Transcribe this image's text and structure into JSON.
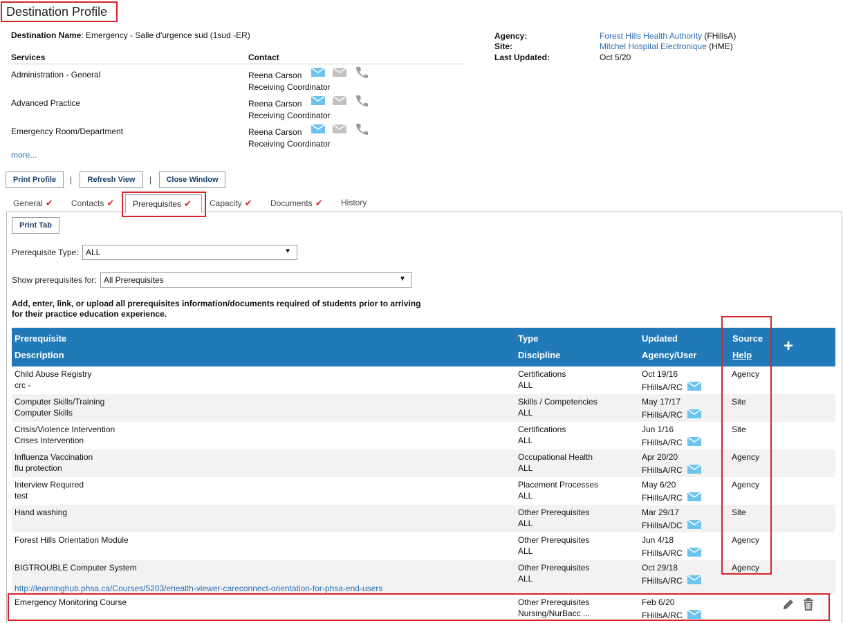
{
  "page_title": "Destination Profile",
  "destination": {
    "label": "Destination Name",
    "value": "Emergency - Salle d'urgence sud (1sud -ER)"
  },
  "services": {
    "header_services": "Services",
    "header_contact": "Contact",
    "items": [
      {
        "name": "Administration - General",
        "contact": "Reena Carson",
        "role": "Receiving Coordinator"
      },
      {
        "name": "Advanced Practice",
        "contact": "Reena Carson",
        "role": "Receiving Coordinator"
      },
      {
        "name": "Emergency Room/Department",
        "contact": "Reena Carson",
        "role": "Receiving Coordinator"
      }
    ],
    "more_link": "more..."
  },
  "meta": {
    "agency_label": "Agency",
    "agency_link": "Forest Hills Health Authority",
    "agency_abbr": "(FHillsA)",
    "site_label": "Site",
    "site_link": "Mitchel Hospital Electronique",
    "site_abbr": "(HME)",
    "updated_label": "Last Updated",
    "updated_value": "Oct 5/20"
  },
  "toolbar": {
    "print_profile": "Print Profile",
    "refresh_view": "Refresh View",
    "close_window": "Close Window",
    "separator": "|"
  },
  "tabs": [
    {
      "label": "General",
      "checked": true
    },
    {
      "label": "Contacts",
      "checked": true
    },
    {
      "label": "Prerequisites",
      "checked": true,
      "active": true
    },
    {
      "label": "Capacity",
      "checked": true
    },
    {
      "label": "Documents",
      "checked": true
    },
    {
      "label": "History",
      "checked": false
    }
  ],
  "check_glyph": "✔",
  "print_tab": "Print Tab",
  "filters": {
    "type_label": "Prerequisite Type:",
    "type_value": "ALL",
    "show_label": "Show prerequisites for:",
    "show_value": "All Prerequisites"
  },
  "notice": "Add, enter, link, or upload all prerequisites information/documents required of students prior to arriving for their practice education experience.",
  "table": {
    "headers": {
      "prerequisite": "Prerequisite",
      "description": "Description",
      "type": "Type",
      "discipline": "Discipline",
      "updated": "Updated",
      "agency_user": "Agency/User",
      "source": "Source",
      "help": "Help",
      "add": "+"
    },
    "rows": [
      {
        "prerequisite": "Child Abuse Registry",
        "description": "crc -",
        "type": "Certifications",
        "discipline": "ALL",
        "updated": "Oct 19/16",
        "user": "FHillsA/RC",
        "source": "Agency"
      },
      {
        "prerequisite": "Computer Skills/Training",
        "description": "Computer Skills",
        "type": "Skills / Competencies",
        "discipline": "ALL",
        "updated": "May 17/17",
        "user": "FHillsA/RC",
        "source": "Site"
      },
      {
        "prerequisite": "Crisis/Violence Intervention",
        "description": "Crises Intervention",
        "type": "Certifications",
        "discipline": "ALL",
        "updated": "Jun 1/16",
        "user": "FHillsA/RC",
        "source": "Site"
      },
      {
        "prerequisite": "Influenza Vaccination",
        "description": "flu protection",
        "type": "Occupational Health",
        "discipline": "ALL",
        "updated": "Apr 20/20",
        "user": "FHillsA/RC",
        "source": "Agency"
      },
      {
        "prerequisite": "Interview Required",
        "description": "test",
        "type": "Placement Processes",
        "discipline": "ALL",
        "updated": "May 6/20",
        "user": "FHillsA/RC",
        "source": "Agency"
      },
      {
        "prerequisite": "Hand washing",
        "description": "",
        "type": "Other Prerequisites",
        "discipline": "ALL",
        "updated": "Mar 29/17",
        "user": "FHillsA/DC",
        "source": "Site"
      },
      {
        "prerequisite": "Forest Hills Orientation Module",
        "description": "",
        "type": "Other Prerequisites",
        "discipline": "ALL",
        "updated": "Jun 4/18",
        "user": "FHillsA/RC",
        "source": "Agency"
      },
      {
        "prerequisite": "BIGTROUBLE Computer System",
        "description": "",
        "type": "Other Prerequisites",
        "discipline": "ALL",
        "updated": "Oct 29/18",
        "user": "FHillsA/RC",
        "source": "Agency",
        "url": "http://learninghub.phsa.ca/Courses/5203/ehealth-viewer-careconnect-orientation-for-phsa-end-users"
      },
      {
        "prerequisite": "Emergency Monitoring Course",
        "description": "",
        "type": "Other Prerequisites",
        "discipline": "Nursing/NurBacc ...",
        "updated": "Feb 6/20",
        "user": "FHillsA/RC",
        "source": "",
        "editable": true
      }
    ]
  },
  "colors": {
    "header_blue": "#2179b8",
    "highlight_red": "#d8232a",
    "mail_blue": "#6ec3ee",
    "icon_grey": "#b5b5b5",
    "link_blue": "#2a6eb0"
  },
  "icons": {
    "mail": "mail-icon",
    "mail_grey": "mail-disabled-icon",
    "phone": "phone-icon",
    "edit": "pencil-icon",
    "delete": "trash-icon"
  }
}
